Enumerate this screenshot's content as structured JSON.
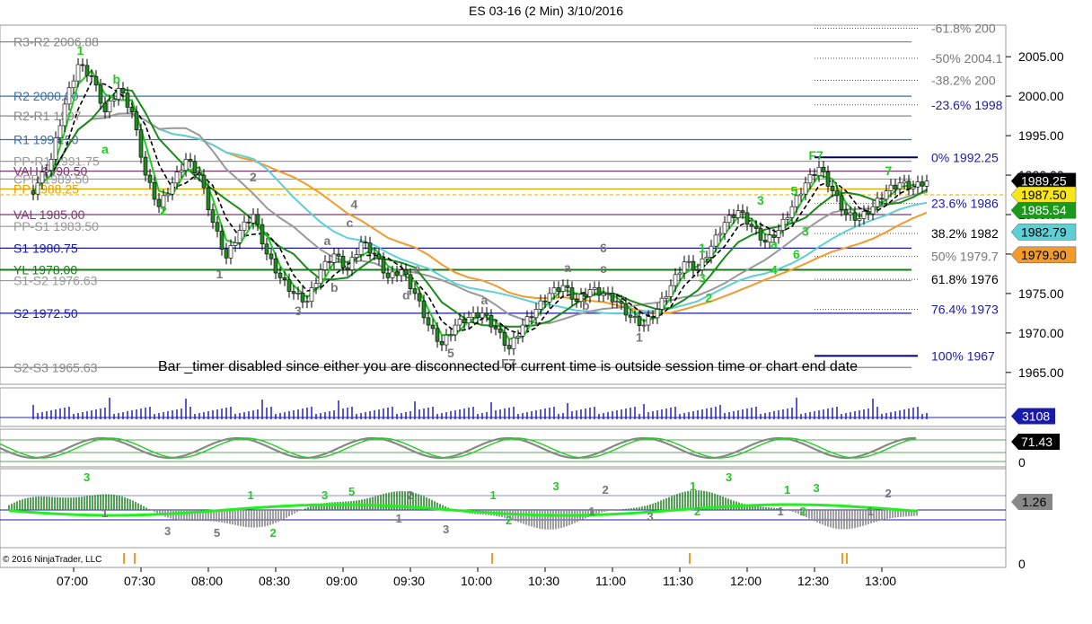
{
  "header": {
    "title": "ES 03-16 (2 Min)  3/10/2016"
  },
  "footer": {
    "copyright": "© 2016 NinjaTrader, LLC",
    "notice": "Bar _timer disabled since either you are disconnected or current time is outside session time or chart end date"
  },
  "chart_data": {
    "type": "candlestick",
    "instrument": "ES 03-16",
    "interval": "2 Min",
    "date": "3/10/2016",
    "x_ticks": [
      "07:00",
      "07:30",
      "08:00",
      "08:30",
      "09:00",
      "09:30",
      "10:00",
      "10:30",
      "11:00",
      "11:30",
      "12:00",
      "12:30",
      "13:00"
    ],
    "y_ticks": [
      "2005.00",
      "2000.00",
      "1995.00",
      "1990.00",
      "1985.00",
      "1980.00",
      "1975.00",
      "1970.00",
      "1965.00"
    ],
    "ylim": [
      1963.5,
      2009
    ],
    "price_path": [
      [
        "06:42",
        1988
      ],
      [
        "06:50",
        1992
      ],
      [
        "06:56",
        1999
      ],
      [
        "07:02",
        2004
      ],
      [
        "07:08",
        2002.5
      ],
      [
        "07:14",
        1998
      ],
      [
        "07:20",
        2001
      ],
      [
        "07:26",
        1998
      ],
      [
        "07:32",
        1990
      ],
      [
        "07:38",
        1986
      ],
      [
        "07:44",
        1989
      ],
      [
        "07:50",
        1992
      ],
      [
        "07:56",
        1990
      ],
      [
        "08:02",
        1984
      ],
      [
        "08:08",
        1979.5
      ],
      [
        "08:14",
        1983
      ],
      [
        "08:20",
        1985
      ],
      [
        "08:26",
        1980
      ],
      [
        "08:32",
        1977
      ],
      [
        "08:38",
        1975
      ],
      [
        "08:44",
        1974
      ],
      [
        "08:50",
        1978
      ],
      [
        "08:56",
        1980
      ],
      [
        "09:02",
        1978
      ],
      [
        "09:08",
        1981.5
      ],
      [
        "09:14",
        1980
      ],
      [
        "09:20",
        1977
      ],
      [
        "09:26",
        1978
      ],
      [
        "09:32",
        1975
      ],
      [
        "09:38",
        1971
      ],
      [
        "09:44",
        1968.5
      ],
      [
        "09:50",
        1971
      ],
      [
        "09:56",
        1972
      ],
      [
        "10:02",
        1972.5
      ],
      [
        "10:08",
        1970.5
      ],
      [
        "10:14",
        1968
      ],
      [
        "10:20",
        1971
      ],
      [
        "10:26",
        1973
      ],
      [
        "10:32",
        1975
      ],
      [
        "10:38",
        1976
      ],
      [
        "10:44",
        1974
      ],
      [
        "10:50",
        1975.5
      ],
      [
        "10:56",
        1975
      ],
      [
        "11:02",
        1974
      ],
      [
        "11:08",
        1972
      ],
      [
        "11:14",
        1971
      ],
      [
        "11:20",
        1973
      ],
      [
        "11:26",
        1976
      ],
      [
        "11:32",
        1979
      ],
      [
        "11:38",
        1978
      ],
      [
        "11:44",
        1981
      ],
      [
        "11:50",
        1984
      ],
      [
        "11:56",
        1985.5
      ],
      [
        "12:02",
        1983.5
      ],
      [
        "12:08",
        1981.5
      ],
      [
        "12:14",
        1983
      ],
      [
        "12:20",
        1986
      ],
      [
        "12:26",
        1989
      ],
      [
        "12:32",
        1991
      ],
      [
        "12:38",
        1988
      ],
      [
        "12:44",
        1985
      ],
      [
        "12:50",
        1984.5
      ],
      [
        "12:56",
        1986
      ],
      [
        "13:02",
        1988
      ],
      [
        "13:08",
        1989
      ],
      [
        "13:14",
        1988.5
      ],
      [
        "13:20",
        1989.25
      ]
    ],
    "levels": [
      {
        "label": "R3-R2 2006.88",
        "value": 2006.88,
        "color": "#888888"
      },
      {
        "label": "R2 2000.00",
        "value": 2000.0,
        "color": "#3a6fa8"
      },
      {
        "label": "R2-R1 1997",
        "value": 1997.5,
        "color": "#888888"
      },
      {
        "label": "R1 1994.50",
        "value": 1994.5,
        "color": "#3a6fa8"
      },
      {
        "label": "PP-R1 1991.75",
        "value": 1991.75,
        "color": "#999999"
      },
      {
        "label": "VAH 1990.50",
        "value": 1990.5,
        "color": "#7a3b6e"
      },
      {
        "label": "CPR 1989.50",
        "value": 1989.5,
        "color": "#999999"
      },
      {
        "label": "PP 1988.25",
        "value": 1988.25,
        "color": "#e8a000"
      },
      {
        "label": "VAL 1985.00",
        "value": 1985.0,
        "color": "#7a3b6e"
      },
      {
        "label": "PP-S1 1983.50",
        "value": 1983.5,
        "color": "#999999"
      },
      {
        "label": "S1 1980.75",
        "value": 1980.75,
        "color": "#1a1aa8"
      },
      {
        "label": "YL 1978.00",
        "value": 1978.0,
        "color": "#1a7a1a"
      },
      {
        "label": "S1-S2 1976.63",
        "value": 1976.63,
        "color": "#999999"
      },
      {
        "label": "S2 1972.50",
        "value": 1972.5,
        "color": "#1a1aa8"
      },
      {
        "label": "S2-S3 1965.63",
        "value": 1965.63,
        "color": "#888888"
      }
    ],
    "fibonacci": [
      {
        "label": "-61.8% 200",
        "value": 2008.6,
        "color": "#777777"
      },
      {
        "label": "-50% 2004.1",
        "value": 2004.8,
        "color": "#777777"
      },
      {
        "label": "-38.2% 200",
        "value": 2002.0,
        "color": "#777777"
      },
      {
        "label": "-23.6% 1998",
        "value": 1998.9,
        "color": "#1a1aa8"
      },
      {
        "label": "0%  1992.25",
        "value": 1992.25,
        "color": "#1a1aa8"
      },
      {
        "label": "23.6% 1986",
        "value": 1986.4,
        "color": "#1a1aa8"
      },
      {
        "label": "38.2% 1982",
        "value": 1982.6,
        "color": "#000000"
      },
      {
        "label": "50% 1979.7",
        "value": 1979.7,
        "color": "#777777"
      },
      {
        "label": "61.8% 1976",
        "value": 1976.8,
        "color": "#000000"
      },
      {
        "label": "76.4% 1973",
        "value": 1973.0,
        "color": "#1a1aa8"
      },
      {
        "label": "100% 1967",
        "value": 1967.1,
        "color": "#1a1aa8"
      }
    ],
    "price_tags": [
      {
        "label": "1989.25",
        "value": 1989.25,
        "bg": "#000000",
        "fg": "#ffffff"
      },
      {
        "label": "1987.50",
        "value": 1987.5,
        "bg": "#f6e61a",
        "fg": "#000000"
      },
      {
        "label": "1985.54",
        "value": 1985.54,
        "bg": "#1a9a1a",
        "fg": "#ffffff"
      },
      {
        "label": "1982.79",
        "value": 1982.79,
        "bg": "#5fcfd6",
        "fg": "#000000"
      },
      {
        "label": "1979.90",
        "value": 1979.9,
        "bg": "#f29a2a",
        "fg": "#000000"
      }
    ],
    "wave_labels": [
      {
        "text": "1",
        "time": "07:03",
        "value": 2005.8,
        "color": "#22cc22"
      },
      {
        "text": "b",
        "time": "07:19",
        "value": 2002.2,
        "color": "#22cc22"
      },
      {
        "text": "a",
        "time": "07:14",
        "value": 1993.3,
        "color": "#22cc22"
      },
      {
        "text": "2",
        "time": "07:40",
        "value": 1985.5,
        "color": "#22cc22"
      },
      {
        "text": "2",
        "time": "08:20",
        "value": 1989.8,
        "color": "#777777"
      },
      {
        "text": "1",
        "time": "08:05",
        "value": 1977.5,
        "color": "#777777"
      },
      {
        "text": "3",
        "time": "08:40",
        "value": 1972.8,
        "color": "#777777"
      },
      {
        "text": "a",
        "time": "08:53",
        "value": 1981.7,
        "color": "#777777"
      },
      {
        "text": "4",
        "time": "09:05",
        "value": 1986.3,
        "color": "#777777"
      },
      {
        "text": "c",
        "time": "09:03",
        "value": 1984.0,
        "color": "#777777"
      },
      {
        "text": "b",
        "time": "08:56",
        "value": 1975.8,
        "color": "#777777"
      },
      {
        "text": "e",
        "time": "09:33",
        "value": 1978.2,
        "color": "#777777"
      },
      {
        "text": "d",
        "time": "09:28",
        "value": 1974.8,
        "color": "#777777"
      },
      {
        "text": "5",
        "time": "09:48",
        "value": 1967.5,
        "color": "#777777"
      },
      {
        "text": "a",
        "time": "10:03",
        "value": 1974.2,
        "color": "#777777"
      },
      {
        "text": "F7",
        "time": "10:12",
        "value": 1966.2,
        "color": "#777777"
      },
      {
        "text": "a",
        "time": "10:40",
        "value": 1978.3,
        "color": "#777777"
      },
      {
        "text": "c",
        "time": "10:56",
        "value": 1978.2,
        "color": "#777777"
      },
      {
        "text": "6",
        "time": "10:56",
        "value": 1980.8,
        "color": "#777777"
      },
      {
        "text": "b",
        "time": "10:48",
        "value": 1973.5,
        "color": "#777777"
      },
      {
        "text": "1",
        "time": "11:12",
        "value": 1969.5,
        "color": "#777777"
      },
      {
        "text": "1",
        "time": "11:40",
        "value": 1980.8,
        "color": "#22cc22"
      },
      {
        "text": "3",
        "time": "11:40",
        "value": 1977.0,
        "color": "#22cc22"
      },
      {
        "text": "2",
        "time": "11:43",
        "value": 1974.5,
        "color": "#22cc22"
      },
      {
        "text": "3",
        "time": "12:06",
        "value": 1986.8,
        "color": "#22cc22"
      },
      {
        "text": "a",
        "time": "12:12",
        "value": 1981.3,
        "color": "#22cc22"
      },
      {
        "text": "4",
        "time": "12:12",
        "value": 1978.0,
        "color": "#22cc22"
      },
      {
        "text": "5",
        "time": "12:21",
        "value": 1988.0,
        "color": "#22cc22"
      },
      {
        "text": "6",
        "time": "12:22",
        "value": 1980.0,
        "color": "#22cc22"
      },
      {
        "text": "3",
        "time": "12:26",
        "value": 1982.9,
        "color": "#22cc22"
      },
      {
        "text": "F7",
        "time": "12:29",
        "value": 1992.5,
        "color": "#22cc22"
      },
      {
        "text": "7",
        "time": "13:03",
        "value": 1990.6,
        "color": "#22cc22"
      }
    ],
    "volume_tag": "3108",
    "oscillator_tag": "71.43",
    "oscillator_axis": "0",
    "histogram_tag": "1.26",
    "bottom_axis": "0",
    "histogram_labels": [
      {
        "text": "3",
        "time": "07:06",
        "dy": -32,
        "color": "#22cc22"
      },
      {
        "text": "1",
        "time": "07:14",
        "dy": 8,
        "color": "#777777"
      },
      {
        "text": "3",
        "time": "07:42",
        "dy": 28,
        "color": "#777777"
      },
      {
        "text": "5",
        "time": "08:04",
        "dy": 30,
        "color": "#777777"
      },
      {
        "text": "1",
        "time": "08:19",
        "dy": -12,
        "color": "#22cc22"
      },
      {
        "text": "2",
        "time": "08:29",
        "dy": 30,
        "color": "#22cc22"
      },
      {
        "text": "3",
        "time": "08:52",
        "dy": -12,
        "color": "#22cc22"
      },
      {
        "text": "5",
        "time": "09:04",
        "dy": -16,
        "color": "#22cc22"
      },
      {
        "text": "2",
        "time": "09:30",
        "dy": -12,
        "color": "#777777"
      },
      {
        "text": "1",
        "time": "09:25",
        "dy": 14,
        "color": "#777777"
      },
      {
        "text": "3",
        "time": "09:46",
        "dy": 26,
        "color": "#777777"
      },
      {
        "text": "1",
        "time": "10:07",
        "dy": -12,
        "color": "#22cc22"
      },
      {
        "text": "2",
        "time": "10:14",
        "dy": 16,
        "color": "#22cc22"
      },
      {
        "text": "3",
        "time": "10:35",
        "dy": -22,
        "color": "#22cc22"
      },
      {
        "text": "1",
        "time": "10:51",
        "dy": 6,
        "color": "#777777"
      },
      {
        "text": "2",
        "time": "10:57",
        "dy": -18,
        "color": "#777777"
      },
      {
        "text": "3",
        "time": "11:17",
        "dy": 12,
        "color": "#777777"
      },
      {
        "text": "1",
        "time": "11:36",
        "dy": -22,
        "color": "#22cc22"
      },
      {
        "text": "2",
        "time": "11:38",
        "dy": 6,
        "color": "#22cc22"
      },
      {
        "text": "3",
        "time": "11:52",
        "dy": -32,
        "color": "#22cc22"
      },
      {
        "text": "1",
        "time": "12:15",
        "dy": 6,
        "color": "#777777"
      },
      {
        "text": "1",
        "time": "12:18",
        "dy": -18,
        "color": "#22cc22"
      },
      {
        "text": "2",
        "time": "12:25",
        "dy": 6,
        "color": "#22cc22"
      },
      {
        "text": "3",
        "time": "12:31",
        "dy": -20,
        "color": "#22cc22"
      },
      {
        "text": "1",
        "time": "12:55",
        "dy": 6,
        "color": "#777777"
      },
      {
        "text": "2",
        "time": "13:03",
        "dy": -14,
        "color": "#777777"
      }
    ],
    "grid": false,
    "colors": {
      "up": "#ffffff",
      "down": "#228822",
      "panel_border": "#999999",
      "volume": "#2020c0"
    }
  }
}
